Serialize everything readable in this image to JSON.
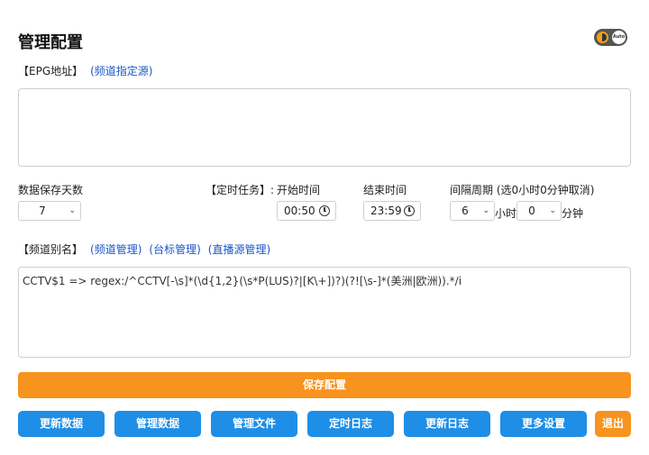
{
  "header": {
    "title": "管理配置"
  },
  "theme_toggle": {
    "label": "Auto"
  },
  "epg": {
    "label": "【EPG地址】",
    "link": "(频道指定源)",
    "value": ""
  },
  "schedule": {
    "keep_days_label": "数据保存天数",
    "keep_days_value": "7",
    "task_label": "【定时任务】:",
    "start_label": "开始时间",
    "start_value": "00:50",
    "end_label": "结束时间",
    "end_value": "23:59",
    "interval_label": "间隔周期 (选0小时0分钟取消)",
    "interval_hours": "6",
    "hours_unit": "小时",
    "interval_minutes": "0",
    "minutes_unit": "分钟"
  },
  "alias": {
    "label": "【频道别名】",
    "links": [
      "(频道管理)",
      "(台标管理)",
      "(直播源管理)"
    ],
    "value": "CCTV$1 => regex:/^CCTV[-\\s]*(\\d{1,2}(\\s*P(LUS)?|[K\\+])?)(?![\\s-]*(美洲|欧洲)).*/i"
  },
  "save_button": "保存配置",
  "buttons": [
    "更新数据",
    "管理数据",
    "管理文件",
    "定时日志",
    "更新日志",
    "更多设置",
    "退出"
  ],
  "colors": {
    "primary": "#1e8ee6",
    "accent": "#f7931e",
    "link": "#1a57c8"
  }
}
